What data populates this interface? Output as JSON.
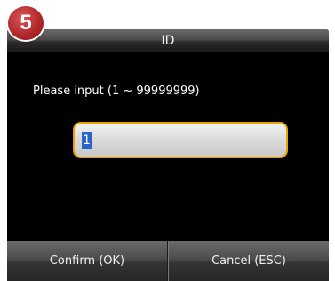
{
  "step_badge": "5",
  "dialog": {
    "title": "ID",
    "prompt": "Please input (1 ~ 99999999)",
    "input": {
      "value": "1"
    }
  },
  "footer": {
    "confirm_label": "Confirm (OK)",
    "cancel_label": "Cancel (ESC)"
  },
  "colors": {
    "input_border": "#e8a400",
    "selection": "#2a63c9",
    "badge": "#b3282b"
  }
}
